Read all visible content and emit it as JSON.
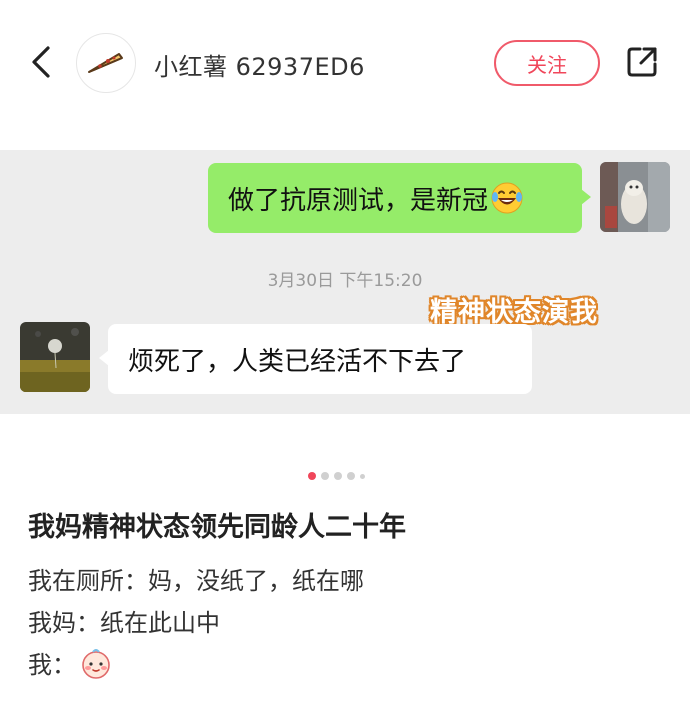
{
  "header": {
    "username": "小红薯 62937ED6",
    "follow_label": "关注"
  },
  "chat": {
    "sent_message": "做了抗原测试，是新冠",
    "timestamp": "3月30日 下午15:20",
    "overlay_caption": "精神状态演我",
    "received_message": "烦死了，人类已经活不下去了"
  },
  "carousel": {
    "total_dots": 5,
    "active_index": 0
  },
  "post": {
    "title": "我妈精神状态领先同龄人二十年",
    "line1": "我在厕所：妈，没纸了，纸在哪",
    "line2": "我妈：纸在此山中",
    "line3": "我："
  },
  "colors": {
    "accent": "#f0465a",
    "sent_bubble": "#95ec69",
    "chat_background": "#ededed",
    "caption_outline": "#e0862a"
  },
  "icons": {
    "back": "chevron-left-icon",
    "share": "share-icon",
    "sent_emoji": "laughing-tears-emoji-icon",
    "face_emoji": "blushing-face-emoji-icon"
  }
}
